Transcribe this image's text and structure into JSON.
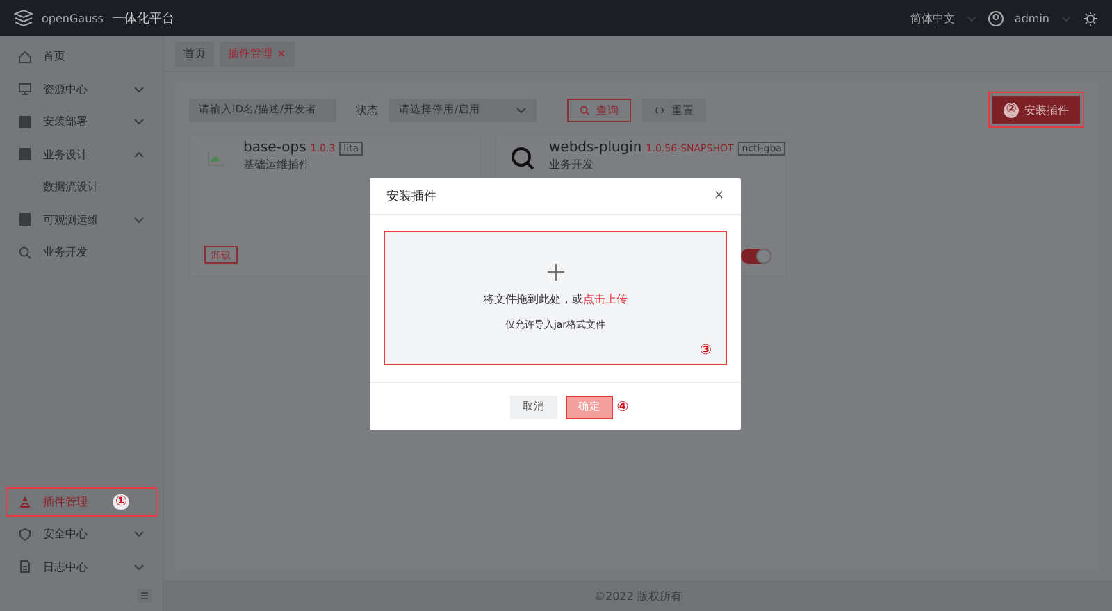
{
  "header": {
    "logo": "openGauss",
    "title": "一体化平台",
    "language": "简体中文",
    "user": "admin"
  },
  "sidebar": {
    "items": [
      {
        "label": "首页",
        "kind": "link",
        "selected": false
      },
      {
        "label": "资源中心",
        "kind": "group",
        "expanded": false,
        "selected": false
      },
      {
        "label": "安装部署",
        "kind": "group",
        "expanded": false,
        "selected": false
      },
      {
        "label": "业务设计",
        "kind": "group",
        "expanded": true,
        "selected": false,
        "children": [
          {
            "label": "数据流设计",
            "selected": false
          }
        ]
      },
      {
        "label": "可观测运维",
        "kind": "group",
        "expanded": false,
        "selected": false
      },
      {
        "label": "业务开发",
        "kind": "link",
        "selected": false
      }
    ],
    "bottom_items": [
      {
        "label": "插件管理",
        "kind": "link",
        "selected": true,
        "highlighted": true,
        "annotation": "①"
      },
      {
        "label": "安全中心",
        "kind": "group",
        "expanded": false,
        "selected": false
      },
      {
        "label": "日志中心",
        "kind": "group",
        "expanded": false,
        "selected": false
      }
    ]
  },
  "tabs": [
    {
      "label": "首页",
      "selected": false
    },
    {
      "label": "插件管理",
      "selected": true,
      "close": "×"
    }
  ],
  "filters": {
    "search": {
      "placeholder": "请输入ID名/描述/开发者"
    },
    "status_label": "状态",
    "status_select": {
      "placeholder": "请选择停用/启用"
    },
    "buttons": [
      {
        "label": "查询",
        "kind": "query"
      },
      {
        "label": "重置",
        "kind": "reset"
      }
    ]
  },
  "install_button": {
    "label": "安装插件",
    "annotation": "②",
    "highlighted": true
  },
  "plugins": [
    {
      "name": "base-ops",
      "version": "1.0.3",
      "tag": "lita",
      "description": "基础运维插件",
      "action": "卸载"
    },
    {
      "name": "webds-plugin",
      "version": "1.0.56-SNAPSHOT",
      "tag": "ncti-gba",
      "description": "业务开发",
      "enabled": true
    }
  ],
  "dialog": {
    "title": "安装插件",
    "close": "×",
    "upload": {
      "prompt": "将文件拖到此处，或",
      "link": "点击上传",
      "hint": "仅允许导入jar格式文件",
      "highlighted": true,
      "annotation": "③"
    },
    "buttons": [
      {
        "label": "取消",
        "kind": "default",
        "highlighted": false
      },
      {
        "label": "确定",
        "kind": "primary",
        "disabled": true,
        "highlighted": true,
        "annotation": "④"
      }
    ]
  },
  "footer": "©2022 版权所有"
}
